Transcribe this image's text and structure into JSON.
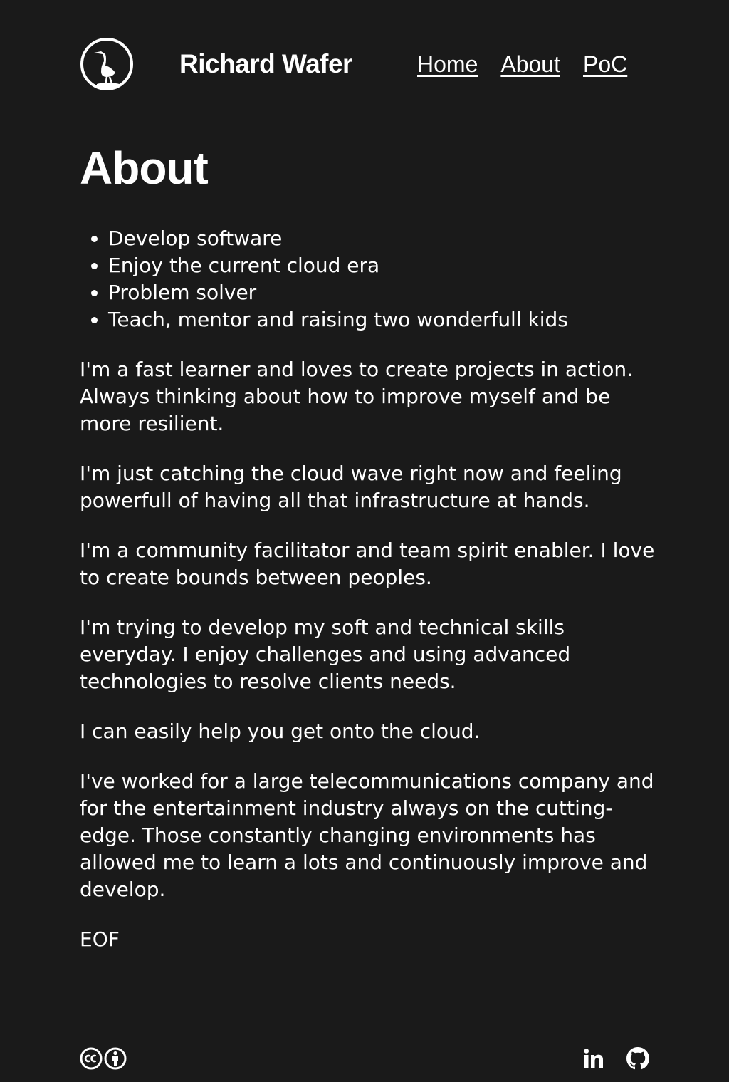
{
  "header": {
    "site_title": "Richard Wafer",
    "nav": [
      {
        "label": "Home"
      },
      {
        "label": "About"
      },
      {
        "label": "PoC"
      }
    ],
    "logo_icon": "heron-logo-icon"
  },
  "main": {
    "title": "About",
    "bullets": [
      "Develop software",
      "Enjoy the current cloud era",
      "Problem solver",
      "Teach, mentor and raising two wonderfull kids"
    ],
    "paragraphs": [
      "I'm a fast learner and loves to create projects in action. Always thinking about how to improve myself and be more resilient.",
      "I'm just catching the cloud wave right now and feeling powerfull of having all that infrastructure at hands.",
      "I'm a community facilitator and team spirit enabler. I love to create bounds between peoples.",
      "I'm trying to develop my soft and technical skills everyday. I enjoy challenges and using advanced technologies to resolve clients needs.",
      "I can easily help you get onto the cloud.",
      "I've worked for a large telecommunications company and for the entertainment industry always on the cutting-edge. Those constantly changing environments has allowed me to learn a lots and continuously improve and develop.",
      "EOF"
    ]
  },
  "footer": {
    "license_icons": [
      "creative-commons-icon",
      "attribution-icon"
    ],
    "social_icons": [
      "linkedin-icon",
      "github-icon"
    ]
  },
  "colors": {
    "background": "#1a1a1a",
    "text": "#ffffff"
  }
}
